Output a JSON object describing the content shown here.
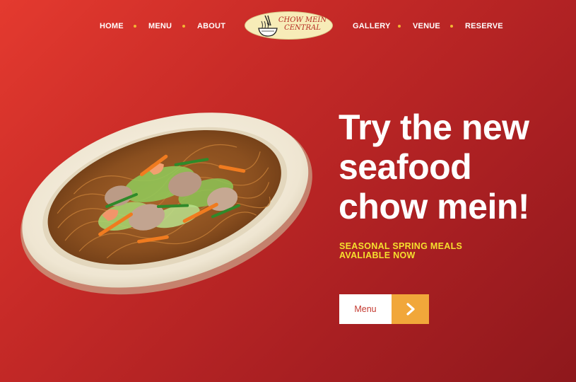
{
  "nav": {
    "left": [
      {
        "label": "HOME"
      },
      {
        "label": "MENU"
      },
      {
        "label": "ABOUT"
      }
    ],
    "right": [
      {
        "label": "GALLERY"
      },
      {
        "label": "VENUE"
      },
      {
        "label": "RESERVE"
      }
    ],
    "logo_text": "CHOW MEIN CENTRAL"
  },
  "hero": {
    "title_line1": "Try the new",
    "title_line2": "seafood",
    "title_line3": "chow mein!",
    "subtitle_line1": "SEASONAL SPRING MEALS",
    "subtitle_line2": "AVALIABLE NOW",
    "button_label": "Menu",
    "arrow_icon": "chevron-right-icon"
  },
  "colors": {
    "background": "#c62a27",
    "nav_dot": "#f2b633",
    "subtitle": "#f5e02e",
    "arrow_button": "#f1a73a",
    "logo_bg": "#f7ecb8"
  }
}
